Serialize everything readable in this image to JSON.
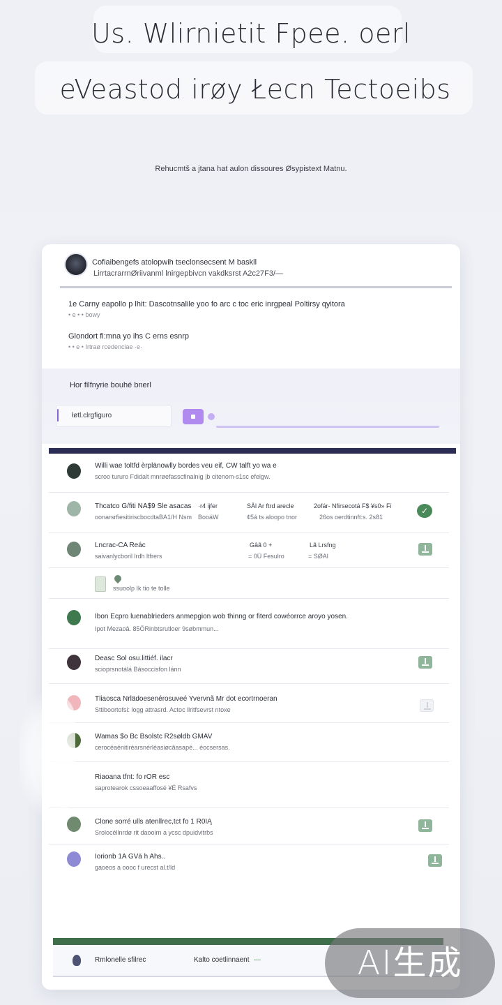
{
  "hero": {
    "title_line1": "Us. Wlirnietit Fpee. oerl",
    "title_line2": "eVeastod irøy Łecn Tectoeibs",
    "subtitle": "Rehucmtš a jtana hat aulon dissoures Øsypistext Matnu."
  },
  "card": {
    "header": {
      "line1": "Cofiaibengefs atolopwih tseclonsecsent M baskll",
      "line2": "LirrtacrarrnØriivanml lnirgepbivcn vakdksrst A2c27F3/—"
    },
    "intro": {
      "line1": "1e Carny eapollo p lhit: Dascotnsalile yoo fo arc c toc eric inrgpeal Poltirsy qyitora",
      "line1_sub": "• e • • bowy",
      "line2": "Glondort fi:mna yo ihs C erns esnrp",
      "line2_sub": "• • e • Irtraø rcedenciae ·e·"
    },
    "search": {
      "label": "Hor filfnyrie bouhé bnerl",
      "value": "łøtl.clrgfiguro"
    },
    "list": [
      {
        "t1": "Willi wae toltfd èrplänowlly bordes veu eif, CW talft yo wa e",
        "t2": "scroo tururo Fdidalt mnrøefasscfinalnig |b citenom-s1sc efelgw.",
        "avatar_color": "#2d3a36"
      },
      {
        "t1": "Thcatco G/fiti NA$9 Sle asacas",
        "t2": "oonarsrfiesitiriscbocdtaBA1/H Nsm",
        "c1": "·r4 ijfer",
        "c1b": "BooáW",
        "c2": "SĀl Ar  ftrd arecle",
        "c2b": "¢5á ts aloopo tnor",
        "c3": "2ofár- Nfirsecotá F$ ¥s0» Fi",
        "c3b": "26os oerdtinnft:s. 2s81",
        "avatar_color": "#9fb5a8",
        "action": "check"
      },
      {
        "t1": "Lncrac-CA Reác",
        "t2": "saivanlycboril lrdh ltfrers",
        "c2": "Gâã 0    +",
        "c2b": "= 0Ü  Fesulro",
        "c3": "Lã Lrsfng",
        "c3b": "= SØAl",
        "avatar_color": "#6f8575",
        "action": "download"
      },
      {
        "t1": "",
        "t2": "ssuoolp Ik tio te tolle",
        "avatar_color": "",
        "action": "file"
      },
      {
        "t1": "Ibon Ecpro luenablrieders anmepgion wob thinng or fiterd cowéorrce aroyo yosen.",
        "t2": "Ipot Mezaoâ. 85ÖRinbtsrutloer 9søbmmun...",
        "avatar_color": "#3f7a4f"
      },
      {
        "t1": "Deasc Sol osu.littiéf. ilacr",
        "t2": "scioprsnotálá Básoccisfon lánn",
        "avatar_color": "#40343c",
        "action": "download"
      },
      {
        "t1": "Tliaosca Nrlädoesenérosuveé Yvervnã Mr dot ecortrnoeran",
        "t2": "Sttiboortofsi: logg attrasrd. Actoc llritfsevrst ntoxe",
        "avatar_color": "#f0b6bc",
        "action": "ghost"
      },
      {
        "t1": "Wamas $o Bc Bsolstc R2søldb GMAV",
        "t2": "cerocéaénitiréarsnérléasiøcâasapé...     éocsersas.",
        "avatar_color": "#4e6a3a"
      },
      {
        "t1": "Riaoana tfnt: fo rOR esc",
        "t2": "saprotearok cssoeaaffosé ¥É Rsafvs",
        "avatar_color": ""
      },
      {
        "t1": "Clone sorré ulls atenllrec,tct fo 1 R0IĄ",
        "t2": "Srolocéllnrdø rit daooirn a ycsc dpuidvitrbs",
        "avatar_color": "#6f8a6e",
        "action": "download"
      },
      {
        "t1": "Iorionb 1A GVä h Ahs..",
        "t2": "gaoeos a oooc f urecst al.t/ld",
        "avatar_color": "#8f8ad6",
        "action": "download"
      }
    ],
    "footer": {
      "label1": "Rmlonelle sfilrec",
      "label2": "Kalto coetlinnaent",
      "dash": "—"
    }
  },
  "watermark": "AI生成",
  "colors": {
    "accent": "#b18af0",
    "success": "#4a8a5a",
    "list_topbar": "#2b2d55"
  }
}
